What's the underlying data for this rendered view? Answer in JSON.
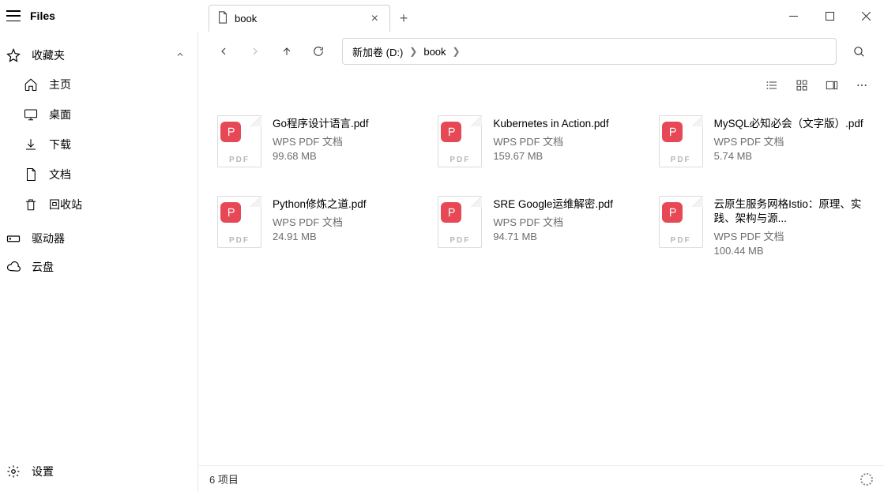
{
  "app": {
    "title": "Files"
  },
  "tab": {
    "label": "book"
  },
  "sidebar": {
    "favorites": {
      "label": "收藏夹"
    },
    "home": {
      "label": "主页"
    },
    "desktop": {
      "label": "桌面"
    },
    "downloads": {
      "label": "下载"
    },
    "documents": {
      "label": "文档"
    },
    "recycle": {
      "label": "回收站"
    },
    "drives": {
      "label": "驱动器"
    },
    "cloud": {
      "label": "云盘"
    },
    "settings": {
      "label": "设置"
    }
  },
  "breadcrumb": {
    "root": "新加卷 (D:)",
    "folder": "book"
  },
  "files": [
    {
      "name": "Go程序设计语言.pdf",
      "type": "WPS PDF 文档",
      "size": "99.68 MB",
      "ext": "PDF"
    },
    {
      "name": "Kubernetes in Action.pdf",
      "type": "WPS PDF 文档",
      "size": "159.67 MB",
      "ext": "PDF"
    },
    {
      "name": "MySQL必知必会（文字版）.pdf",
      "type": "WPS PDF 文档",
      "size": "5.74 MB",
      "ext": "PDF"
    },
    {
      "name": "Python修炼之道.pdf",
      "type": "WPS PDF 文档",
      "size": "24.91 MB",
      "ext": "PDF"
    },
    {
      "name": "SRE  Google运维解密.pdf",
      "type": "WPS PDF 文档",
      "size": "94.71 MB",
      "ext": "PDF"
    },
    {
      "name": "云原生服务网格Istio：原理、实践、架构与源...",
      "type": "WPS PDF 文档",
      "size": "100.44 MB",
      "ext": "PDF"
    }
  ],
  "statusbar": {
    "count": "6 项目"
  }
}
